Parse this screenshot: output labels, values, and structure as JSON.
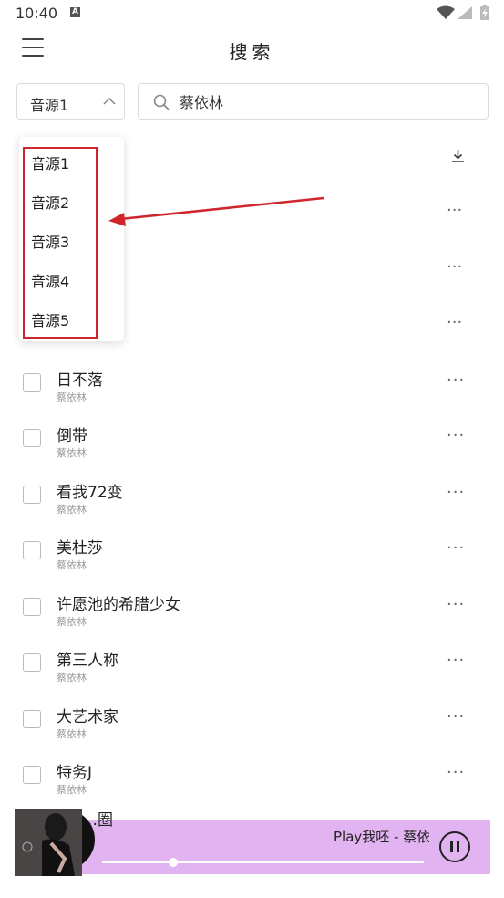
{
  "status": {
    "time": "10:40",
    "notif_glyph": "A"
  },
  "header": {
    "title": "搜索",
    "menu_icon": "hamburger-menu-icon"
  },
  "source_select": {
    "value": "音源1",
    "icon": "chevron-up-icon"
  },
  "search": {
    "value": "蔡依林",
    "icon": "search-icon"
  },
  "dropdown": {
    "options": [
      "音源1",
      "音源2",
      "音源3",
      "音源4",
      "音源5"
    ],
    "highlight_color": "#d0252d"
  },
  "songs": [
    {
      "title": "日不落",
      "artist": "蔡依林"
    },
    {
      "title": "倒带",
      "artist": "蔡依林"
    },
    {
      "title": "看我72变",
      "artist": "蔡依林"
    },
    {
      "title": "美杜莎",
      "artist": "蔡依林"
    },
    {
      "title": "许愿池的希腊少女",
      "artist": "蔡依林"
    },
    {
      "title": "第三人称",
      "artist": "蔡依林"
    },
    {
      "title": "大艺术家",
      "artist": "蔡依林"
    },
    {
      "title": "特务J",
      "artist": "蔡依林"
    }
  ],
  "row_more_label": "···",
  "partial_row_title": "…圈",
  "player": {
    "title": "Play我呸 - 蔡依林",
    "progress": 0.22,
    "accent": "#e2b3f1",
    "state_icon": "pause-icon"
  }
}
